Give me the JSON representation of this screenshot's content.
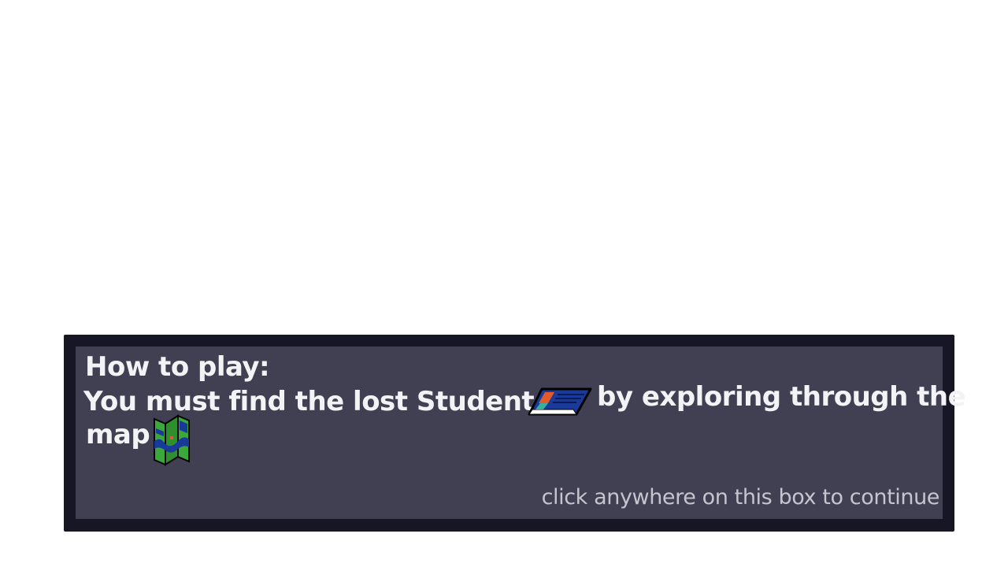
{
  "dialog": {
    "title": "How to play:",
    "instruction_part1": "You must find the lost Student ID",
    "instruction_part2": "by exploring through the",
    "instruction_part3": "map",
    "continue_hint": "click anywhere on this box to continue",
    "icons": [
      "student-id-card-icon",
      "folded-map-icon"
    ]
  },
  "colors": {
    "background": "#ffffff",
    "dialog_border": "#161625",
    "dialog_fill": "#414053",
    "text": "#f3f3f6",
    "hint_text": "#c5c5cf"
  }
}
